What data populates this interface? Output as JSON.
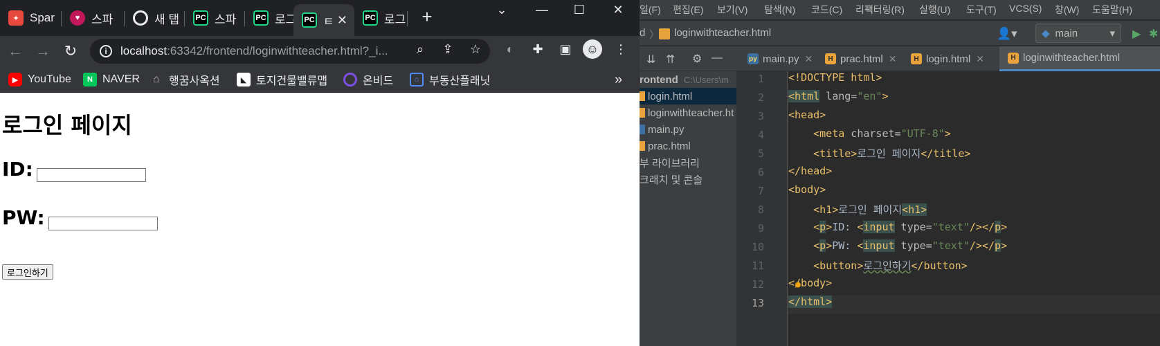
{
  "browser": {
    "tabs": [
      {
        "label": "Spar",
        "icon": "sparta-icon",
        "color": "#e8493f"
      },
      {
        "label": "스파",
        "icon": "heart-code-icon",
        "color": "#c2185b"
      },
      {
        "label": "새 탭",
        "icon": "chrome-icon",
        "color": "#5f6368"
      },
      {
        "label": "스파",
        "icon": "pycharm-icon",
        "color": "#21d789"
      },
      {
        "label": "로그",
        "icon": "pycharm-icon",
        "color": "#21d789"
      },
      {
        "label": "ㅌ",
        "icon": "pycharm-icon",
        "color": "#21d789"
      },
      {
        "label": "로그",
        "icon": "pycharm-icon",
        "color": "#21d789"
      }
    ],
    "new_tab": "+",
    "address": {
      "host": "localhost",
      "rest": ":63342/frontend/loginwithteacher.html?_i..."
    },
    "bookmarks": [
      {
        "label": "YouTube",
        "icon": "youtube-icon",
        "color": "#ff0000"
      },
      {
        "label": "NAVER",
        "icon": "naver-icon",
        "color": "#03c75a"
      },
      {
        "label": "행꿈사옥션",
        "icon": "house-icon",
        "color": "#bbbbbb"
      },
      {
        "label": "토지건물밸류맵",
        "icon": "valuemap-icon",
        "color": "#ffffff"
      },
      {
        "label": "온비드",
        "icon": "onbid-icon",
        "color": "#7b4fe0"
      },
      {
        "label": "부동산플래닛",
        "icon": "planet-icon",
        "color": "#4f8ef7"
      }
    ],
    "bookmarks_more": "»"
  },
  "page": {
    "title": "로그인 페이지",
    "id_label": "ID:",
    "pw_label": "PW:",
    "button_label": "로그인하기"
  },
  "ide": {
    "menus": [
      "일(F)",
      "편집(E)",
      "보기(V)",
      "탐색(N)",
      "코드(C)",
      "리팩터링(R)",
      "실행(U)",
      "도구(T)",
      "VCS(S)",
      "창(W)",
      "도움말(H)"
    ],
    "breadcrumb_prefix": "d",
    "breadcrumb_file": "loginwithteacher.html",
    "branch": "main",
    "editor_tabs": [
      {
        "label": "main.py",
        "type": "py"
      },
      {
        "label": "prac.html",
        "type": "html"
      },
      {
        "label": "login.html",
        "type": "html"
      },
      {
        "label": "loginwithteacher.html",
        "type": "html",
        "active": true
      }
    ],
    "project_root": "rontend",
    "project_path": "C:\\Users\\m",
    "project_files": [
      "login.html",
      "loginwithteacher.ht",
      "main.py",
      "prac.html"
    ],
    "project_extra": [
      "부 라이브러리",
      "크래치 및 콘솔"
    ],
    "line_numbers": [
      "1",
      "2",
      "3",
      "4",
      "5",
      "6",
      "7",
      "8",
      "9",
      "10",
      "11",
      "12",
      "13"
    ],
    "code": {
      "l1": "<!DOCTYPE html>",
      "l2a": "<html",
      "l2b": " lang=",
      "l2c": "\"en\"",
      "l2d": ">",
      "l3": "<head>",
      "l4a": "    <meta",
      "l4b": " charset=",
      "l4c": "\"UTF-8\"",
      "l4d": ">",
      "l5a": "    <title>",
      "l5b": "로그인 페이지",
      "l5c": "</title>",
      "l6": "</head>",
      "l7": "<body>",
      "l8a": "    <h1>",
      "l8b": "로그인 페이지",
      "l8c": "<h1>",
      "l9a": "    <",
      "l9b": "p",
      "l9c": ">",
      "l9d": "ID: ",
      "l9e": "<",
      "l9f": "input",
      "l9g": " type=",
      "l9h": "\"text\"",
      "l9i": "/></",
      "l9j": "p",
      "l9k": ">",
      "l10a": "    <",
      "l10b": "p",
      "l10c": ">",
      "l10d": "PW: ",
      "l10e": "<",
      "l10f": "input",
      "l10g": " type=",
      "l10h": "\"text\"",
      "l10i": "/></",
      "l10j": "p",
      "l10k": ">",
      "l11a": "    <button>",
      "l11b": "로그인하기",
      "l11c": "</button>",
      "l12": "</body>",
      "l13": "</html>"
    }
  }
}
